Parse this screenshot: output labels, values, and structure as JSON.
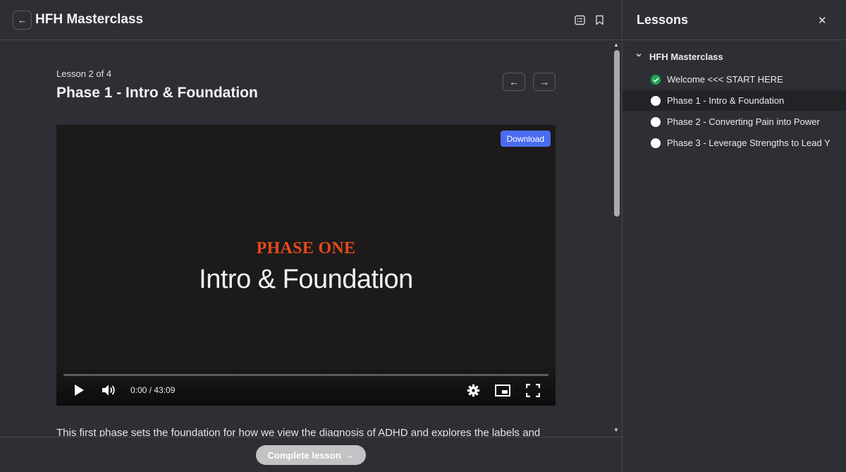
{
  "header": {
    "back_icon": "arrow-left-icon",
    "title": "HFH Masterclass",
    "icons": [
      "list-icon",
      "bookmark-icon"
    ]
  },
  "lesson": {
    "count": "Lesson 2 of 4",
    "title": "Phase 1 - Intro & Foundation",
    "prev_icon": "arrow-left-icon",
    "next_icon": "arrow-right-icon"
  },
  "video": {
    "download_label": "Download",
    "phase_label": "PHASE ONE",
    "phase_subtitle": "Intro & Foundation",
    "time": "0:00 / 43:09",
    "progress": 0,
    "accent": "#e5491c"
  },
  "description": "This first phase sets the foundation for how we view the diagnosis of ADHD and explores the labels and",
  "footer": {
    "complete_label": "Complete lesson",
    "complete_icon": "arrow-right-icon"
  },
  "sidebar": {
    "title": "Lessons",
    "close_icon": "close-icon",
    "section": {
      "title": "HFH Masterclass",
      "expanded": true
    },
    "items": [
      {
        "label": "Welcome <<< START HERE",
        "status": "complete"
      },
      {
        "label": "Phase 1 - Intro & Foundation",
        "status": "current"
      },
      {
        "label": "Phase 2 - Converting Pain into Power",
        "status": "incomplete"
      },
      {
        "label": "Phase 3 - Leverage Strengths to Lead Y",
        "status": "incomplete"
      }
    ]
  },
  "colors": {
    "background": "#2d2f34",
    "download_button": "#4a6cf0",
    "complete_check": "#1fa655",
    "complete_button": "#c2c3c5"
  }
}
